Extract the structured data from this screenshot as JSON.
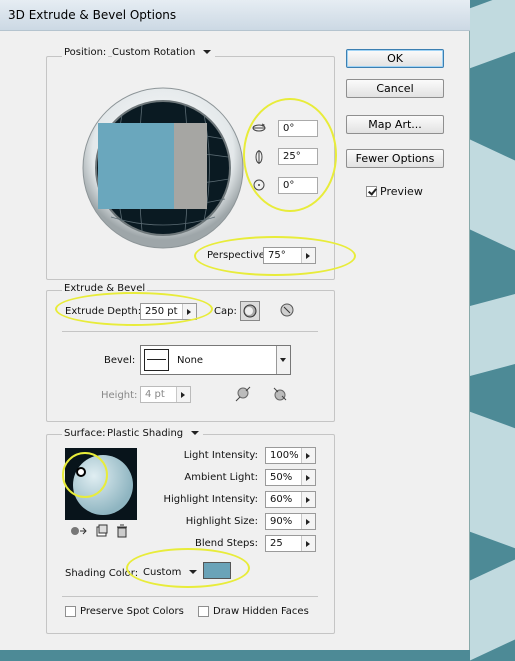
{
  "window": {
    "title": "3D Extrude & Bevel Options"
  },
  "position": {
    "label": "Position:",
    "preset": "Custom Rotation",
    "rotation_x": "0°",
    "rotation_y": "25°",
    "rotation_z": "0°",
    "perspective_label": "Perspective:",
    "perspective_value": "75°"
  },
  "buttons": {
    "ok": "OK",
    "cancel": "Cancel",
    "map_art": "Map Art...",
    "fewer_options": "Fewer Options"
  },
  "preview": {
    "label": "Preview",
    "checked": true
  },
  "extrude": {
    "section_title": "Extrude & Bevel",
    "depth_label": "Extrude Depth:",
    "depth_value": "250 pt",
    "cap_label": "Cap:",
    "bevel_label": "Bevel:",
    "bevel_value": "None",
    "height_label": "Height:",
    "height_value": "4 pt"
  },
  "surface": {
    "label": "Surface:",
    "value": "Plastic Shading",
    "light_intensity_label": "Light Intensity:",
    "light_intensity_value": "100%",
    "ambient_light_label": "Ambient Light:",
    "ambient_light_value": "50%",
    "highlight_intensity_label": "Highlight Intensity:",
    "highlight_intensity_value": "60%",
    "highlight_size_label": "Highlight Size:",
    "highlight_size_value": "90%",
    "blend_steps_label": "Blend Steps:",
    "blend_steps_value": "25",
    "shading_color_label": "Shading Color:",
    "shading_color_value": "Custom",
    "shading_swatch_color": "#6aa3b8"
  },
  "options": {
    "preserve_spot_colors": "Preserve Spot Colors",
    "draw_hidden_faces": "Draw Hidden Faces"
  }
}
